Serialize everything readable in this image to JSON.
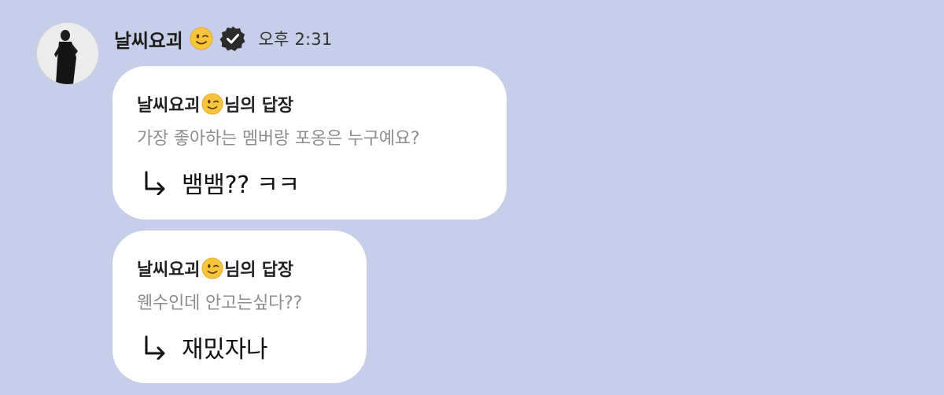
{
  "message": {
    "sender_name": "날씨요괴",
    "sender_emoji": "winking-face",
    "verified_badge": "verified-check-icon",
    "time": "오후 2:31"
  },
  "replies": [
    {
      "reply_to_name": "날씨요괴",
      "reply_suffix": "님의 답장",
      "quoted_text": "가장 좋아하는 멤버랑 포옹은 누구예요?",
      "answer_text": "뱀뱀?? ㅋㅋ"
    },
    {
      "reply_to_name": "날씨요괴",
      "reply_suffix": "님의 답장",
      "quoted_text": "웬수인데 안고는싶다??",
      "answer_text": "재밌자나"
    }
  ],
  "colors": {
    "background": "#c7cee9",
    "bubble": "#ffffff",
    "quoted_text": "#8d8d8d",
    "emoji_face": "#f7c53b"
  }
}
